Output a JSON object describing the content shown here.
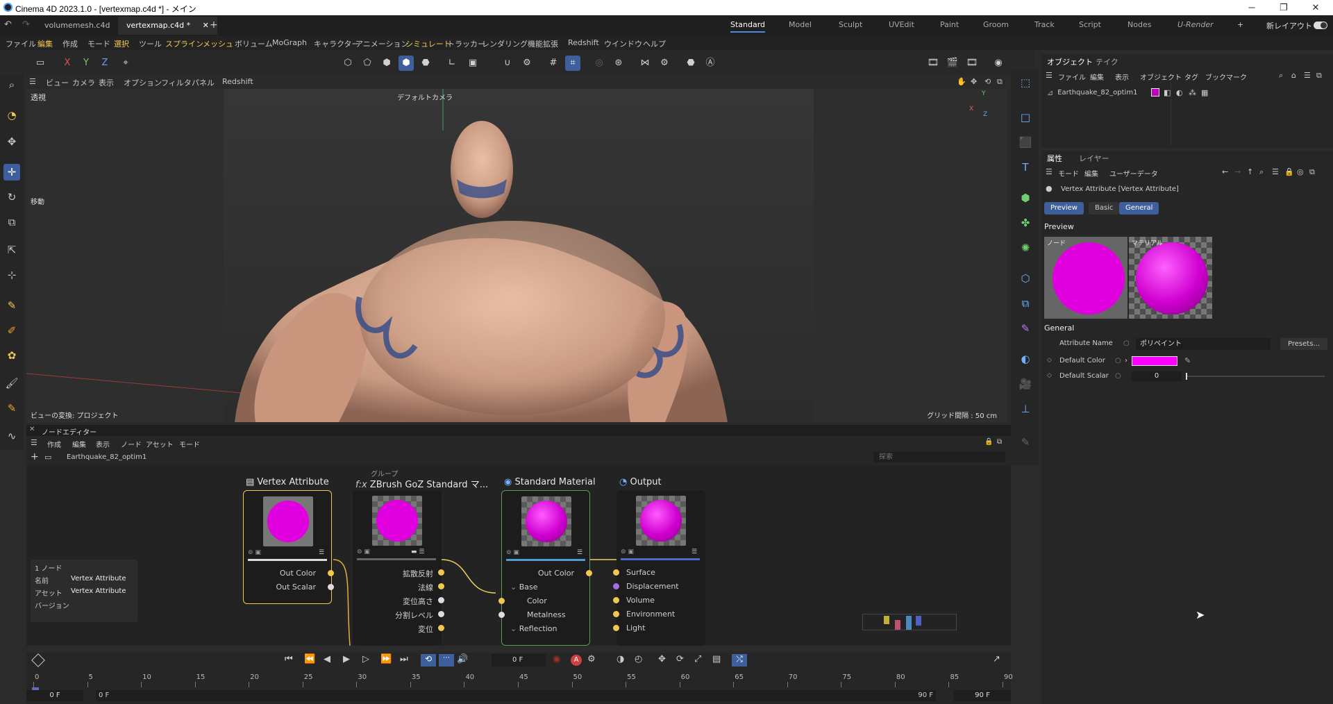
{
  "window": {
    "title": "Cinema 4D 2023.1.0 - [vertexmap.c4d *] - メイン"
  },
  "tabs": {
    "docs": [
      "volumemesh.c4d",
      "vertexmap.c4d *"
    ],
    "layouts": [
      "Standard",
      "Model",
      "Sculpt",
      "UVEdit",
      "Paint",
      "Groom",
      "Track",
      "Script",
      "Nodes",
      "U-Render"
    ],
    "new_layout": "新レイアウト"
  },
  "menubar": [
    "ファイル",
    "編集",
    "作成",
    "モード",
    "選択",
    "ツール",
    "スプライン",
    "メッシュ",
    "ボリューム",
    "MoGraph",
    "キャラクター",
    "アニメーション",
    "シミュレート",
    "トラッカー",
    "レンダリング",
    "機能拡張",
    "Redshift",
    "ウインドウ",
    "ヘルプ"
  ],
  "toolbar": {
    "x": "X",
    "y": "Y",
    "z": "Z"
  },
  "viewport": {
    "menu": [
      "ビュー",
      "カメラ",
      "表示",
      "オプション",
      "フィルタ",
      "パネル",
      "Redshift"
    ],
    "label_persp": "透視",
    "camera": "デフォルトカメラ",
    "move_label": "移動",
    "transform_label": "ビューの変換: プロジェクト",
    "grid_label": "グリッド間隔 : 50 cm",
    "axis": {
      "x": "X",
      "y": "Y",
      "z": "Z"
    }
  },
  "object_manager": {
    "tabs": [
      "オブジェクト",
      "テイク"
    ],
    "menu": [
      "ファイル",
      "編集",
      "表示",
      "オブジェクト",
      "タグ",
      "ブックマーク"
    ],
    "object_name": "Earthquake_82_optim1"
  },
  "attribute_manager": {
    "tabs": [
      "属性",
      "レイヤー"
    ],
    "menu": [
      "モード",
      "編集",
      "ユーザーデータ"
    ],
    "title": "Vertex Attribute [Vertex Attribute]",
    "subtabs": [
      "Preview",
      "Basic",
      "General"
    ],
    "preview_section": "Preview",
    "preview_node": "ノード",
    "preview_material": "マテリアル",
    "general_section": "General",
    "attr_name_label": "Attribute Name",
    "attr_name_value": "ポリペイント",
    "presets": "Presets...",
    "default_color_label": "Default Color",
    "default_color": "#ff00ff",
    "default_scalar_label": "Default Scalar",
    "default_scalar_value": "0"
  },
  "node_editor": {
    "title": "ノードエディター",
    "menu": [
      "作成",
      "編集",
      "表示",
      "ノード",
      "アセット",
      "モード"
    ],
    "breadcrumb": "Earthquake_82_optim1",
    "search_placeholder": "探索",
    "group_label": "グループ",
    "nodes": {
      "vertex_attribute": {
        "title": "Vertex Attribute",
        "ports": [
          "Out Color",
          "Out Scalar"
        ]
      },
      "zbrush": {
        "title": "ZBrush GoZ Standard マ...",
        "ports": [
          "拡散反射",
          "法線",
          "変位高さ",
          "分割レベル",
          "変位"
        ]
      },
      "standard": {
        "title": "Standard Material",
        "out": "Out Color",
        "ports": [
          "Base",
          "Color",
          "Metalness",
          "Reflection"
        ]
      },
      "output": {
        "title": "Output",
        "ports": [
          "Surface",
          "Displacement",
          "Volume",
          "Environment",
          "Light"
        ]
      }
    },
    "info": {
      "count": "1 ノード",
      "name_label": "名前",
      "name_value": "Vertex Attribute",
      "asset_label": "アセット",
      "asset_value": "Vertex Attribute",
      "version_label": "バージョン"
    }
  },
  "timeline": {
    "current_frame": "0 F",
    "ticks": [
      "0",
      "5",
      "10",
      "15",
      "20",
      "25",
      "30",
      "35",
      "40",
      "45",
      "50",
      "55",
      "60",
      "65",
      "70",
      "75",
      "80",
      "85",
      "90"
    ],
    "start": "0 F",
    "min": "0 F",
    "max": "90 F",
    "end": "90 F"
  }
}
